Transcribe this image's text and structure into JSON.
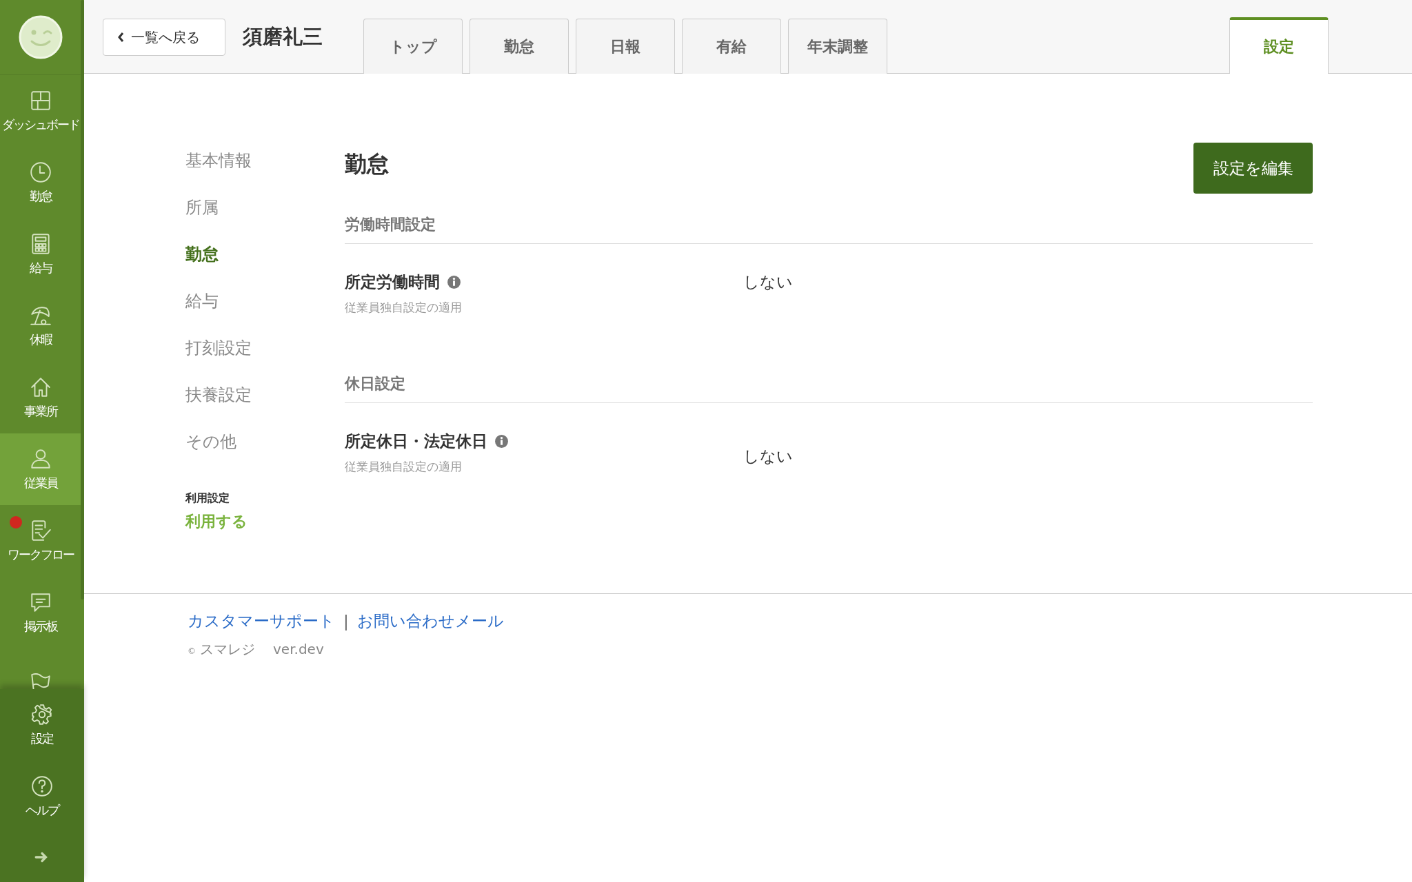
{
  "sidebar": {
    "items": [
      {
        "label": "ダッシュボード",
        "selected": false,
        "notification": false
      },
      {
        "label": "勤怠",
        "selected": false,
        "notification": false
      },
      {
        "label": "給与",
        "selected": false,
        "notification": false
      },
      {
        "label": "休暇",
        "selected": false,
        "notification": false
      },
      {
        "label": "事業所",
        "selected": false,
        "notification": false
      },
      {
        "label": "従業員",
        "selected": true,
        "notification": false
      },
      {
        "label": "ワークフロー",
        "selected": false,
        "notification": true
      },
      {
        "label": "掲示板",
        "selected": false,
        "notification": false
      },
      {
        "selected": false,
        "notification": false
      }
    ],
    "bottom_items": [
      {
        "label": "設定"
      },
      {
        "label": "ヘルプ"
      }
    ]
  },
  "header": {
    "back_button": "一覧へ戻る",
    "employee_name": "須磨礼三",
    "tabs": [
      {
        "label": "トップ",
        "selected": false
      },
      {
        "label": "勤怠",
        "selected": false
      },
      {
        "label": "日報",
        "selected": false
      },
      {
        "label": "有給",
        "selected": false
      },
      {
        "label": "年末調整",
        "selected": false
      }
    ],
    "settings_tab": {
      "label": "設定",
      "selected": true
    }
  },
  "settings_nav": {
    "items": [
      {
        "label": "基本情報",
        "selected": false
      },
      {
        "label": "所属",
        "selected": false
      },
      {
        "label": "勤怠",
        "selected": true
      },
      {
        "label": "給与",
        "selected": false
      },
      {
        "label": "打刻設定",
        "selected": false
      },
      {
        "label": "扶養設定",
        "selected": false
      },
      {
        "label": "その他",
        "selected": false
      }
    ],
    "usage_label": "利用設定",
    "usage_value": "利用する"
  },
  "panel": {
    "title": "勤怠",
    "edit_button": "設定を編集",
    "sections": [
      {
        "title": "労働時間設定",
        "rows": [
          {
            "label": "所定労働時間",
            "sublabel": "従業員独自設定の適用",
            "value": "しない"
          }
        ]
      },
      {
        "title": "休日設定",
        "rows": [
          {
            "label": "所定休日・法定休日",
            "sublabel": "従業員独自設定の適用",
            "value": "しない"
          }
        ]
      }
    ]
  },
  "footer": {
    "links": [
      "カスタマーサポート",
      "お問い合わせメール"
    ],
    "separator": "|",
    "copyright_mark": "©",
    "company": "スマレジ",
    "version": "ver.dev"
  }
}
